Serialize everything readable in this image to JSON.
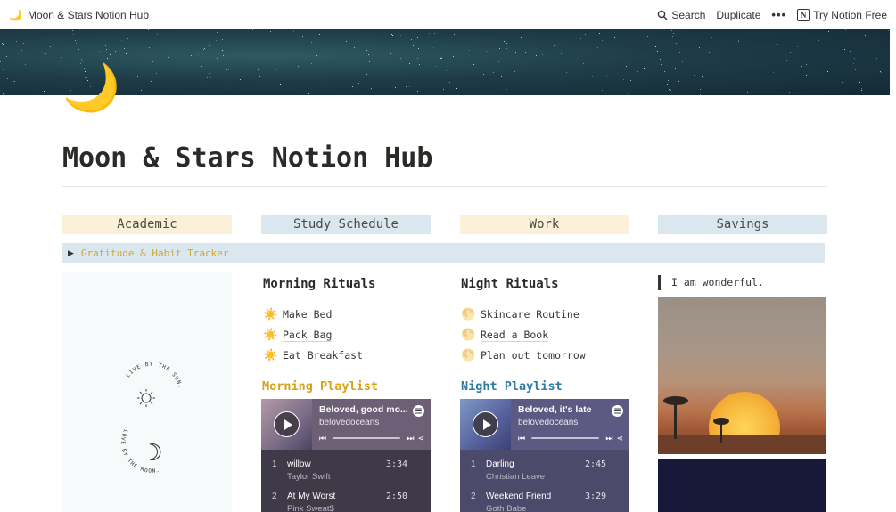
{
  "topbar": {
    "page_icon": "🌙",
    "breadcrumb": "Moon & Stars Notion Hub",
    "search_label": "Search",
    "duplicate_label": "Duplicate",
    "more_label": "•••",
    "try_label": "Try Notion Free",
    "notion_logo": "N"
  },
  "page": {
    "icon": "🌙",
    "title": "Moon & Stars Notion Hub"
  },
  "tabs": [
    {
      "label": "Academic"
    },
    {
      "label": "Study Schedule"
    },
    {
      "label": "Work"
    },
    {
      "label": "Savings"
    }
  ],
  "toggle": {
    "label": "Gratitude & Habit Tracker",
    "color": "#d4a62a"
  },
  "left_panel": {
    "top_arc_text": ".LIVE BY THE SUN.",
    "bottom_arc_text": ".LOVE BY THE MOON.",
    "sun_icon": "sun-icon",
    "moon_icon": "crescent-moon-icon"
  },
  "morning": {
    "heading": "Morning Rituals",
    "items": [
      {
        "icon": "☀️",
        "label": "Make Bed"
      },
      {
        "icon": "☀️",
        "label": "Pack Bag"
      },
      {
        "icon": "☀️",
        "label": "Eat Breakfast"
      }
    ],
    "playlist_title": "Morning Playlist",
    "player": {
      "title": "Beloved, good mo...",
      "artist": "belovedoceans",
      "tracks": [
        {
          "num": "1",
          "name": "willow",
          "artist": "Taylor Swift",
          "duration": "3:34"
        },
        {
          "num": "2",
          "name": "At My Worst",
          "artist": "Pink Sweat$",
          "duration": "2:50"
        }
      ]
    }
  },
  "night": {
    "heading": "Night Rituals",
    "items": [
      {
        "icon": "🌕",
        "label": "Skincare Routine"
      },
      {
        "icon": "🌕",
        "label": "Read a Book"
      },
      {
        "icon": "🌕",
        "label": "Plan out tomorrow"
      }
    ],
    "playlist_title": "Night Playlist",
    "player": {
      "title": "Beloved, it's late",
      "artist": "belovedoceans",
      "tracks": [
        {
          "num": "1",
          "name": "Darling",
          "artist": "Christian Leave",
          "duration": "2:45"
        },
        {
          "num": "2",
          "name": "Weekend Friend",
          "artist": "Goth Babe",
          "duration": "3:29"
        }
      ]
    }
  },
  "right": {
    "quote": "I am wonderful."
  },
  "colors": {
    "cover": "#1e3c48",
    "tab_yellow": "#fbf0d8",
    "tab_blue": "#dbe7ee",
    "morning_accent": "#d9a214",
    "night_accent": "#2e7aa3"
  }
}
